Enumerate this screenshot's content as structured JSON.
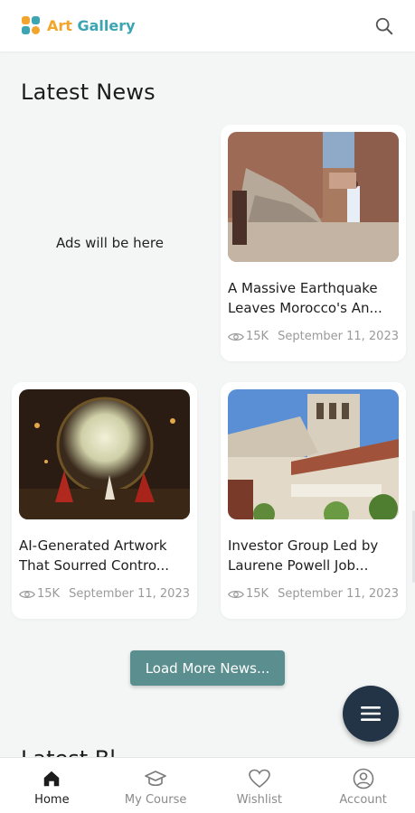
{
  "header": {
    "app_name_part1": "Art",
    "app_name_part2": "Gallery",
    "search_icon": "search-icon"
  },
  "latest_news": {
    "title": "Latest News",
    "ad_placeholder": "Ads will be here",
    "articles": [
      {
        "title_line1": "A Massive Earthquake",
        "title_line2": "Leaves Morocco's An...",
        "views": "15K",
        "date": "September 11, 2023"
      },
      {
        "title_line1": "AI-Generated Artwork",
        "title_line2": "That Sourred Contro...",
        "views": "15K",
        "date": "September 11, 2023"
      },
      {
        "title_line1": "Investor Group Led by",
        "title_line2": "Laurene Powell Job...",
        "views": "15K",
        "date": "September 11, 2023"
      }
    ],
    "load_more_label": "Load More News..."
  },
  "next_section": {
    "title": "Latest Bl"
  },
  "bottom_nav": {
    "items": [
      {
        "label": "Home",
        "icon": "home-icon",
        "active": true
      },
      {
        "label": "My Course",
        "icon": "graduation-cap-icon",
        "active": false
      },
      {
        "label": "Wishlist",
        "icon": "heart-icon",
        "active": false
      },
      {
        "label": "Account",
        "icon": "user-circle-icon",
        "active": false
      }
    ]
  },
  "colors": {
    "accent_button": "#5b8f8f",
    "fab": "#243447",
    "logo_orange": "#f2a52a",
    "logo_teal": "#3ba5b4",
    "background": "#f4f6f6"
  }
}
